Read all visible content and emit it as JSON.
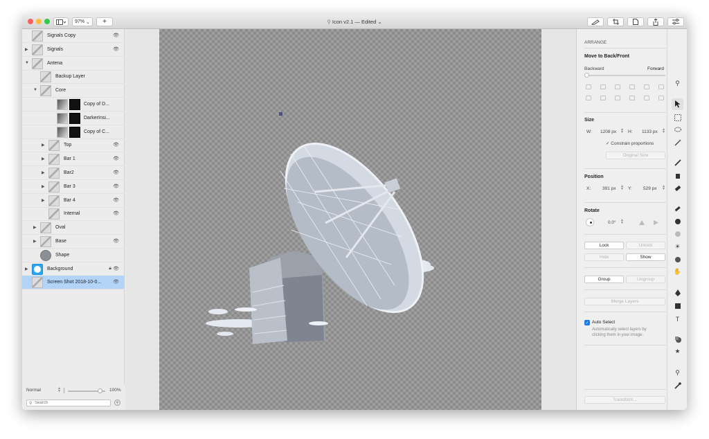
{
  "window": {
    "title": "Icon v2.1 — Edited",
    "zoom": "97%",
    "add_label": "+"
  },
  "layers": [
    {
      "name": "Signals Copy",
      "indent": 0,
      "disc": "",
      "eye": true,
      "lock": false,
      "selected": false
    },
    {
      "name": "Signals",
      "indent": 0,
      "disc": "▶",
      "eye": true,
      "lock": false,
      "selected": false
    },
    {
      "name": "Antena",
      "indent": 0,
      "disc": "▼",
      "eye": false,
      "lock": false,
      "selected": false
    },
    {
      "name": "Backup Layer",
      "indent": 1,
      "disc": "",
      "eye": false,
      "lock": false,
      "selected": false
    },
    {
      "name": "Core",
      "indent": 1,
      "disc": "▼",
      "eye": false,
      "lock": false,
      "selected": false
    },
    {
      "name": "Copy of D...",
      "indent": 2,
      "disc": "",
      "eye": false,
      "lock": false,
      "selected": false,
      "mask": true
    },
    {
      "name": "DarkerInsi...",
      "indent": 2,
      "disc": "",
      "eye": false,
      "lock": false,
      "selected": false,
      "mask": true
    },
    {
      "name": "Copy of C...",
      "indent": 2,
      "disc": "",
      "eye": false,
      "lock": false,
      "selected": false,
      "mask": true
    },
    {
      "name": "Top",
      "indent": 2,
      "disc": "▶",
      "eye": true,
      "lock": false,
      "selected": false
    },
    {
      "name": "Bar 1",
      "indent": 2,
      "disc": "▶",
      "eye": true,
      "lock": false,
      "selected": false
    },
    {
      "name": "Bar2",
      "indent": 2,
      "disc": "▶",
      "eye": true,
      "lock": false,
      "selected": false
    },
    {
      "name": "Bar 3",
      "indent": 2,
      "disc": "▶",
      "eye": true,
      "lock": false,
      "selected": false
    },
    {
      "name": "Bar 4",
      "indent": 2,
      "disc": "▶",
      "eye": true,
      "lock": false,
      "selected": false
    },
    {
      "name": "Internal",
      "indent": 2,
      "disc": "",
      "eye": true,
      "lock": false,
      "selected": false
    },
    {
      "name": "Oval",
      "indent": 1,
      "disc": "▶",
      "eye": false,
      "lock": false,
      "selected": false
    },
    {
      "name": "Base",
      "indent": 1,
      "disc": "▶",
      "eye": true,
      "lock": false,
      "selected": false
    },
    {
      "name": "Shape",
      "indent": 1,
      "disc": "",
      "eye": false,
      "lock": false,
      "selected": false,
      "circle": true
    },
    {
      "name": "Background",
      "indent": 0,
      "disc": "▶",
      "eye": true,
      "lock": true,
      "selected": false,
      "blue": true
    },
    {
      "name": "Screen Shot 2018-10-0...",
      "indent": 0,
      "disc": "",
      "eye": true,
      "lock": false,
      "selected": true
    }
  ],
  "layers_footer": {
    "blend_mode": "Normal",
    "opacity": "100%",
    "opacity_value": 0.85,
    "search_placeholder": "Search"
  },
  "inspector": {
    "arrange_title": "ARRANGE",
    "move_label": "Move to Back/Front",
    "backward": "Backward",
    "forward": "Forward",
    "size_title": "Size",
    "w_label": "W:",
    "w_value": "1208 px",
    "h_label": "H:",
    "h_value": "1133 px",
    "constrain": "Constrain proportions",
    "original_size": "Original Size",
    "position_title": "Position",
    "x_label": "X:",
    "x_value": "391 px",
    "y_label": "Y:",
    "y_value": "529 px",
    "rotate_title": "Rotate",
    "rotate_value": "0.0°",
    "lock": "Lock",
    "unlock": "Unlock",
    "hide": "Hide",
    "show": "Show",
    "group": "Group",
    "ungroup": "Ungroup",
    "merge": "Merge Layers",
    "auto_select": "Auto Select",
    "auto_select_desc1": "Automatically select layers by",
    "auto_select_desc2": "clicking them in your image.",
    "transform": "Transform..."
  },
  "colors": {
    "selection": "#b3d3f7",
    "accent": "#1a7ae8",
    "close": "#fc605c",
    "minimize": "#fdbc40",
    "zoom": "#34c84a",
    "canvas_check": "#9e9e9e"
  }
}
